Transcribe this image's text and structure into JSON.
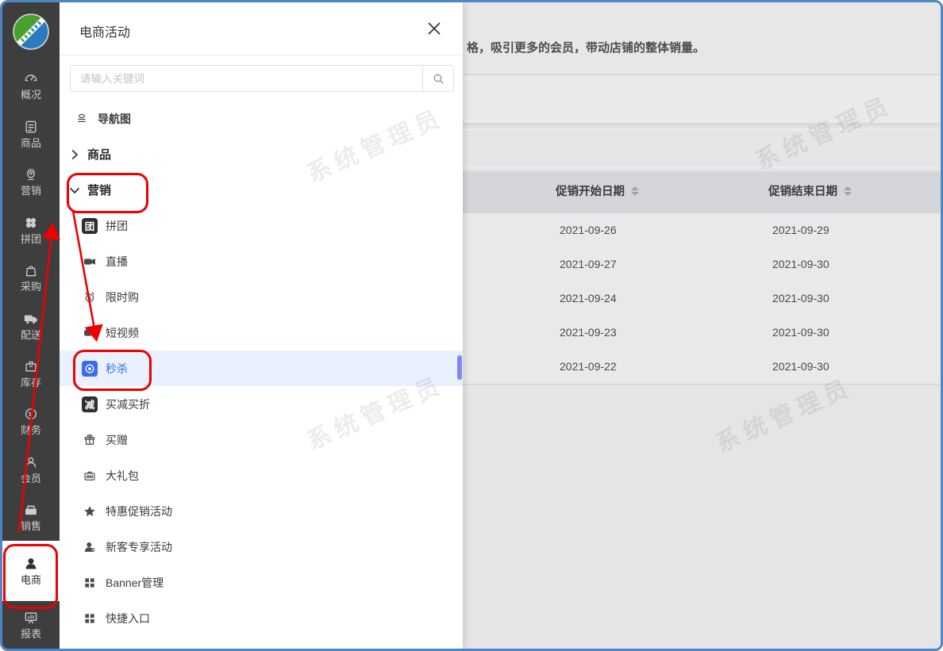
{
  "colors": {
    "annotation_red": "#ee0000",
    "accent_blue": "#3a6af0",
    "sidebar_bg": "#3e3e3e",
    "active_row_bg": "#e9f1fe",
    "frame_blue": "#4e86c6"
  },
  "sidebar": {
    "items": [
      {
        "label": "概况",
        "icon": "gauge-icon"
      },
      {
        "label": "商品",
        "icon": "goods-doc-icon"
      },
      {
        "label": "营销",
        "icon": "marketing-badge-icon"
      },
      {
        "label": "拼团",
        "icon": "four-dots-icon"
      },
      {
        "label": "采购",
        "icon": "purchase-bag-icon"
      },
      {
        "label": "配送",
        "icon": "delivery-truck-icon"
      },
      {
        "label": "库存",
        "icon": "inventory-box-icon"
      },
      {
        "label": "财务",
        "icon": "finance-coin-icon"
      },
      {
        "label": "会员",
        "icon": "member-person-icon"
      },
      {
        "label": "销售",
        "icon": "sales-register-icon"
      },
      {
        "label": "电商",
        "icon": "ecommerce-person-icon",
        "selected": true
      },
      {
        "label": "报表",
        "icon": "report-board-icon"
      }
    ]
  },
  "panel": {
    "title": "电商活动",
    "close": "close-icon",
    "search": {
      "placeholder": "请输入关键词",
      "icon": "search-icon"
    },
    "menu": [
      {
        "label": "导航图",
        "icon": "navmap-icon"
      },
      {
        "label": "商品",
        "icon": "chevron-right-icon"
      },
      {
        "label": "营销",
        "icon": "chevron-down-icon",
        "expanded": true
      },
      {
        "label": "拼团",
        "icon": "tuan-tile-icon"
      },
      {
        "label": "直播",
        "icon": "live-camera-icon"
      },
      {
        "label": "限时购",
        "icon": "alarm-clock-icon"
      },
      {
        "label": "短视频",
        "icon": "video-camera-icon"
      },
      {
        "label": "秒杀",
        "icon": "seckill-tile-icon",
        "active": true
      },
      {
        "label": "买减买折",
        "icon": "jian-tile-icon"
      },
      {
        "label": "买赠",
        "icon": "gift-icon"
      },
      {
        "label": "大礼包",
        "icon": "case-icon"
      },
      {
        "label": "特惠促销活动",
        "icon": "star-icon"
      },
      {
        "label": "新客专享活动",
        "icon": "person-plus-icon"
      },
      {
        "label": "Banner管理",
        "icon": "grid-icon"
      },
      {
        "label": "快捷入口",
        "icon": "grid-icon"
      }
    ]
  },
  "background": {
    "description_fragment": "格，吸引更多的会员，带动店铺的整体销量。",
    "watermark": "系统管理员",
    "table": {
      "columns": [
        {
          "label": "促销开始日期"
        },
        {
          "label": "促销结束日期"
        }
      ],
      "rows": [
        {
          "start": "2021-09-26",
          "end": "2021-09-29"
        },
        {
          "start": "2021-09-27",
          "end": "2021-09-30"
        },
        {
          "start": "2021-09-24",
          "end": "2021-09-30"
        },
        {
          "start": "2021-09-23",
          "end": "2021-09-30"
        },
        {
          "start": "2021-09-22",
          "end": "2021-09-30"
        }
      ]
    }
  },
  "annotations": {
    "highlighted_items": [
      "营销",
      "秒杀",
      "电商"
    ]
  }
}
